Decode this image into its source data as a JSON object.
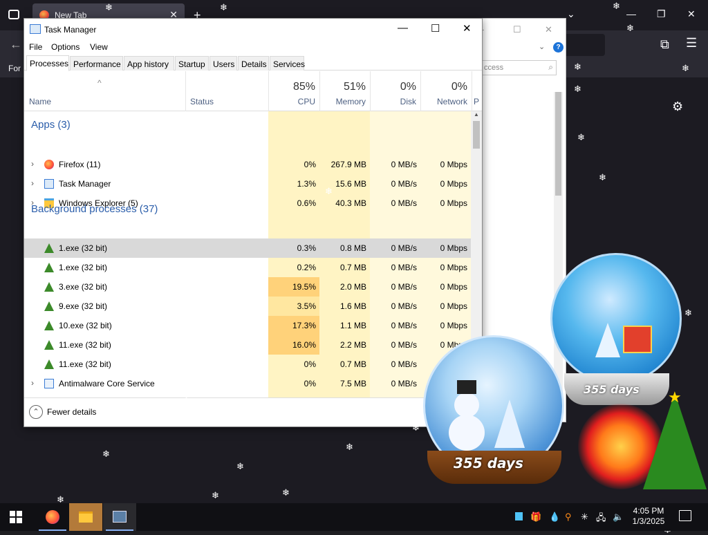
{
  "firefox": {
    "tab_title": "New Tab",
    "bookmark_label": "For"
  },
  "explorer": {
    "search_placeholder": "ccess"
  },
  "taskmanager": {
    "title": "Task Manager",
    "menu": [
      "File",
      "Options",
      "View"
    ],
    "tabs": [
      "Processes",
      "Performance",
      "App history",
      "Startup",
      "Users",
      "Details",
      "Services"
    ],
    "active_tab": "Processes",
    "columns": {
      "name": "Name",
      "status": "Status",
      "cpu": {
        "pct": "85%",
        "label": "CPU"
      },
      "memory": {
        "pct": "51%",
        "label": "Memory"
      },
      "disk": {
        "pct": "0%",
        "label": "Disk"
      },
      "network": {
        "pct": "0%",
        "label": "Network"
      },
      "power": "P"
    },
    "groups": {
      "apps": "Apps (3)",
      "background": "Background processes (37)"
    },
    "apps": [
      {
        "name": "Firefox (11)",
        "cpu": "0%",
        "mem": "267.9 MB",
        "disk": "0 MB/s",
        "net": "0 Mbps",
        "icon": "firefox-icon"
      },
      {
        "name": "Task Manager",
        "cpu": "1.3%",
        "mem": "15.6 MB",
        "disk": "0 MB/s",
        "net": "0 Mbps",
        "icon": "task-manager-icon"
      },
      {
        "name": "Windows Explorer (5)",
        "cpu": "0.6%",
        "mem": "40.3 MB",
        "disk": "0 MB/s",
        "net": "0 Mbps",
        "icon": "folder-icon"
      }
    ],
    "background": [
      {
        "name": "1.exe (32 bit)",
        "cpu": "0.3%",
        "mem": "0.8 MB",
        "disk": "0 MB/s",
        "net": "0 Mbps",
        "icon": "christmas-tree-icon"
      },
      {
        "name": "1.exe (32 bit)",
        "cpu": "0.2%",
        "mem": "0.7 MB",
        "disk": "0 MB/s",
        "net": "0 Mbps",
        "icon": "christmas-tree-icon"
      },
      {
        "name": "3.exe (32 bit)",
        "cpu": "19.5%",
        "mem": "2.0 MB",
        "disk": "0 MB/s",
        "net": "0 Mbps",
        "icon": "christmas-tree-icon"
      },
      {
        "name": "9.exe (32 bit)",
        "cpu": "3.5%",
        "mem": "1.6 MB",
        "disk": "0 MB/s",
        "net": "0 Mbps",
        "icon": "christmas-tree-icon"
      },
      {
        "name": "10.exe (32 bit)",
        "cpu": "17.3%",
        "mem": "1.1 MB",
        "disk": "0 MB/s",
        "net": "0 Mbps",
        "icon": "christmas-tree-icon"
      },
      {
        "name": "11.exe (32 bit)",
        "cpu": "16.0%",
        "mem": "2.2 MB",
        "disk": "0 MB/s",
        "net": "0 Mbps",
        "icon": "christmas-tree-icon"
      },
      {
        "name": "11.exe (32 bit)",
        "cpu": "0%",
        "mem": "0.7 MB",
        "disk": "0 MB/s",
        "net": "0 Mb",
        "icon": "christmas-tree-icon"
      },
      {
        "name": "Antimalware Core Service",
        "cpu": "0%",
        "mem": "7.5 MB",
        "disk": "0 MB/s",
        "net": "",
        "icon": "service-icon"
      }
    ],
    "fewer_details": "Fewer details"
  },
  "globes": {
    "days_left": "355 days",
    "days_right": "355 days"
  },
  "taskbar": {
    "time": "4:05 PM",
    "date": "1/3/2025"
  },
  "colors": {
    "cpu_heat_low": "#fff4c4",
    "cpu_heat_mid": "#ffe7a0",
    "cpu_heat_high": "#ffd27a",
    "group_header": "#2a5daa",
    "taskbar_active": "#b37a3a"
  }
}
